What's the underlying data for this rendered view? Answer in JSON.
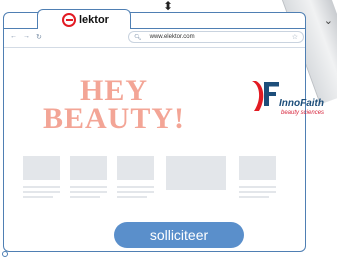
{
  "browser": {
    "tab_title": "lektor",
    "url": "www.elektor.com",
    "nav_icons": [
      "back-arrow-icon",
      "forward-arrow-icon",
      "reload-icon"
    ],
    "address_icons": [
      "search-icon",
      "star-icon"
    ]
  },
  "ad": {
    "headline_line1": "HEY",
    "headline_line2": "BEAUTY!",
    "brand_name": "InnoFaith",
    "brand_tagline": "beauty sciences",
    "cta_label": "solliciteer"
  },
  "colors": {
    "frame": "#4f7fb3",
    "headline": "#f3a596",
    "cta": "#5a8fcb",
    "brand_red": "#e21b23",
    "brand_blue": "#1d4e7a"
  }
}
